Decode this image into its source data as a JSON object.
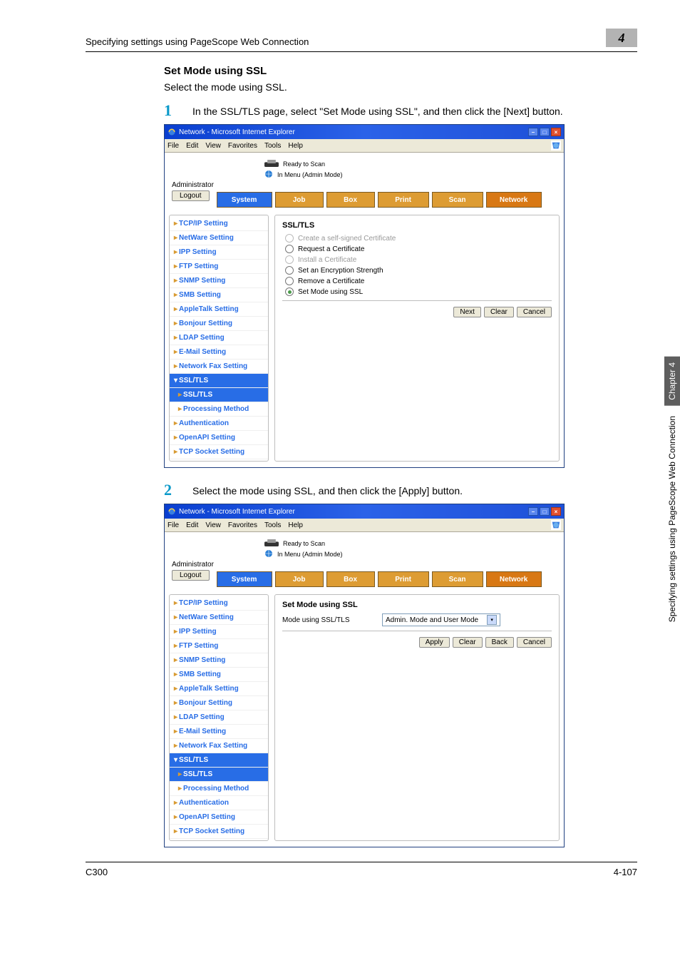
{
  "breadcrumb": "Specifying settings using PageScope Web Connection",
  "chapter_num": "4",
  "section_title": "Set Mode using SSL",
  "section_text": "Select the mode using SSL.",
  "step1": {
    "num": "1",
    "text": "In the SSL/TLS page, select \"Set Mode using SSL\", and then click the [Next] button."
  },
  "step2": {
    "num": "2",
    "text": "Select the mode using SSL, and then click the [Apply] button."
  },
  "ie": {
    "title": "Network - Microsoft Internet Explorer",
    "menus": [
      "File",
      "Edit",
      "View",
      "Favorites",
      "Tools",
      "Help"
    ],
    "status_ready": "Ready to Scan",
    "status_menu": "In Menu (Admin Mode)",
    "admin": "Administrator",
    "logout": "Logout",
    "tabs": {
      "system": "System",
      "job": "Job",
      "box": "Box",
      "print": "Print",
      "scan": "Scan",
      "network": "Network"
    },
    "nav": {
      "tcpip": "TCP/IP Setting",
      "netware": "NetWare Setting",
      "ipp": "IPP Setting",
      "ftp": "FTP Setting",
      "snmp": "SNMP Setting",
      "smb": "SMB Setting",
      "appletalk": "AppleTalk Setting",
      "bonjour": "Bonjour Setting",
      "ldap": "LDAP Setting",
      "email": "E-Mail Setting",
      "netfax": "Network Fax Setting",
      "ssltls_cat": "SSL/TLS",
      "ssltls_sub": "SSL/TLS",
      "proc": "Processing Method",
      "auth": "Authentication",
      "openapi": "OpenAPI Setting",
      "tcpsock": "TCP Socket Setting"
    }
  },
  "panel1": {
    "heading": "SSL/TLS",
    "opts": {
      "create": "Create a self-signed Certificate",
      "request": "Request a Certificate",
      "install": "Install a Certificate",
      "setenc": "Set an Encryption Strength",
      "remove": "Remove a Certificate",
      "setmode": "Set Mode using SSL"
    },
    "btns": {
      "next": "Next",
      "clear": "Clear",
      "cancel": "Cancel"
    }
  },
  "panel2": {
    "heading": "Set Mode using SSL",
    "label": "Mode using SSL/TLS",
    "value": "Admin. Mode and User Mode",
    "btns": {
      "apply": "Apply",
      "clear": "Clear",
      "back": "Back",
      "cancel": "Cancel"
    }
  },
  "side": {
    "chapter": "Chapter 4",
    "label": "Specifying settings using PageScope Web Connection"
  },
  "footer": {
    "left": "C300",
    "right": "4-107"
  }
}
